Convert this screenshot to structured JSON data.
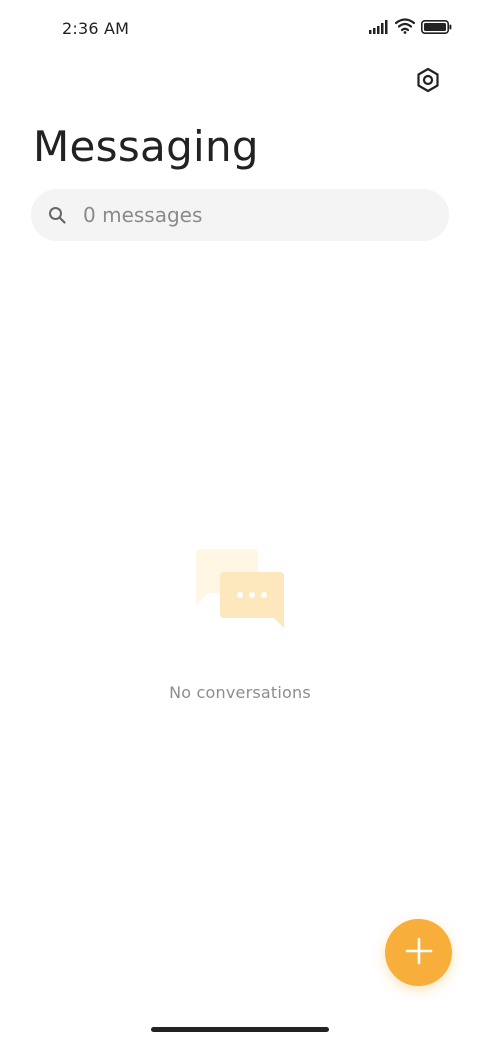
{
  "status_bar": {
    "time": "2:36 AM",
    "icons": [
      "signal-icon",
      "wifi-icon",
      "battery-icon"
    ]
  },
  "header": {
    "settings_icon": "settings-icon",
    "title": "Messaging"
  },
  "search": {
    "placeholder": "0 messages",
    "value": ""
  },
  "empty_state": {
    "icon": "chat-bubbles-icon",
    "text": "No conversations"
  },
  "fab": {
    "icon": "plus-icon",
    "color": "#f7ae3a"
  },
  "colors": {
    "accent": "#f7ae3a",
    "illustration_back": "#fff6e3",
    "illustration_front": "#fde7bd"
  }
}
